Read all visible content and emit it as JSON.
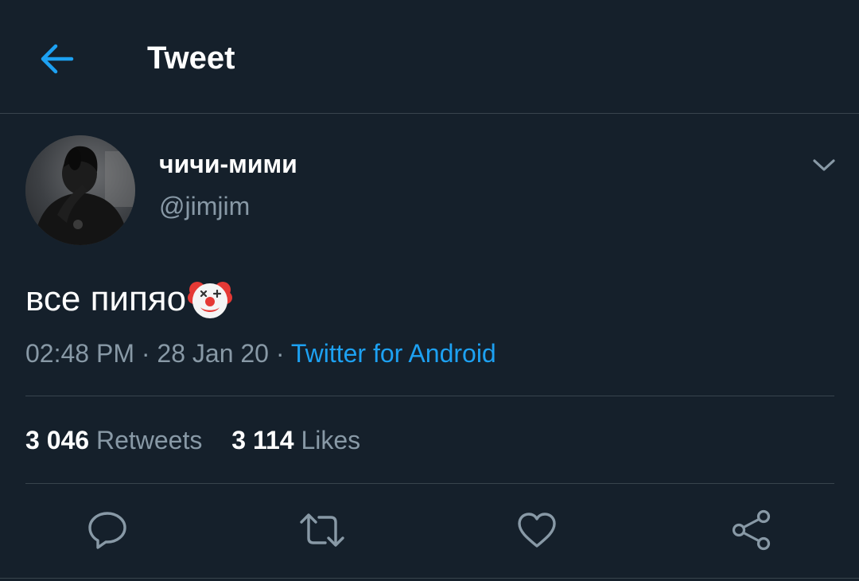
{
  "header": {
    "title": "Tweet",
    "back_icon": "arrow-left-icon"
  },
  "author": {
    "display_name": "чичи-мими",
    "handle": "@jimjim"
  },
  "tweet": {
    "text": "все пипяо",
    "emoji": "clown-face",
    "time": "02:48 PM",
    "date": "28 Jan 20",
    "separator": "·",
    "source": "Twitter for Android"
  },
  "stats": {
    "retweets_count": "3 046",
    "retweets_label": "Retweets",
    "likes_count": "3 114",
    "likes_label": "Likes"
  },
  "actions": [
    "reply-icon",
    "retweet-icon",
    "like-icon",
    "share-icon"
  ],
  "colors": {
    "background": "#15202b",
    "accent": "#1da1f2",
    "secondary_text": "#8899a6",
    "divider": "#38444d"
  }
}
